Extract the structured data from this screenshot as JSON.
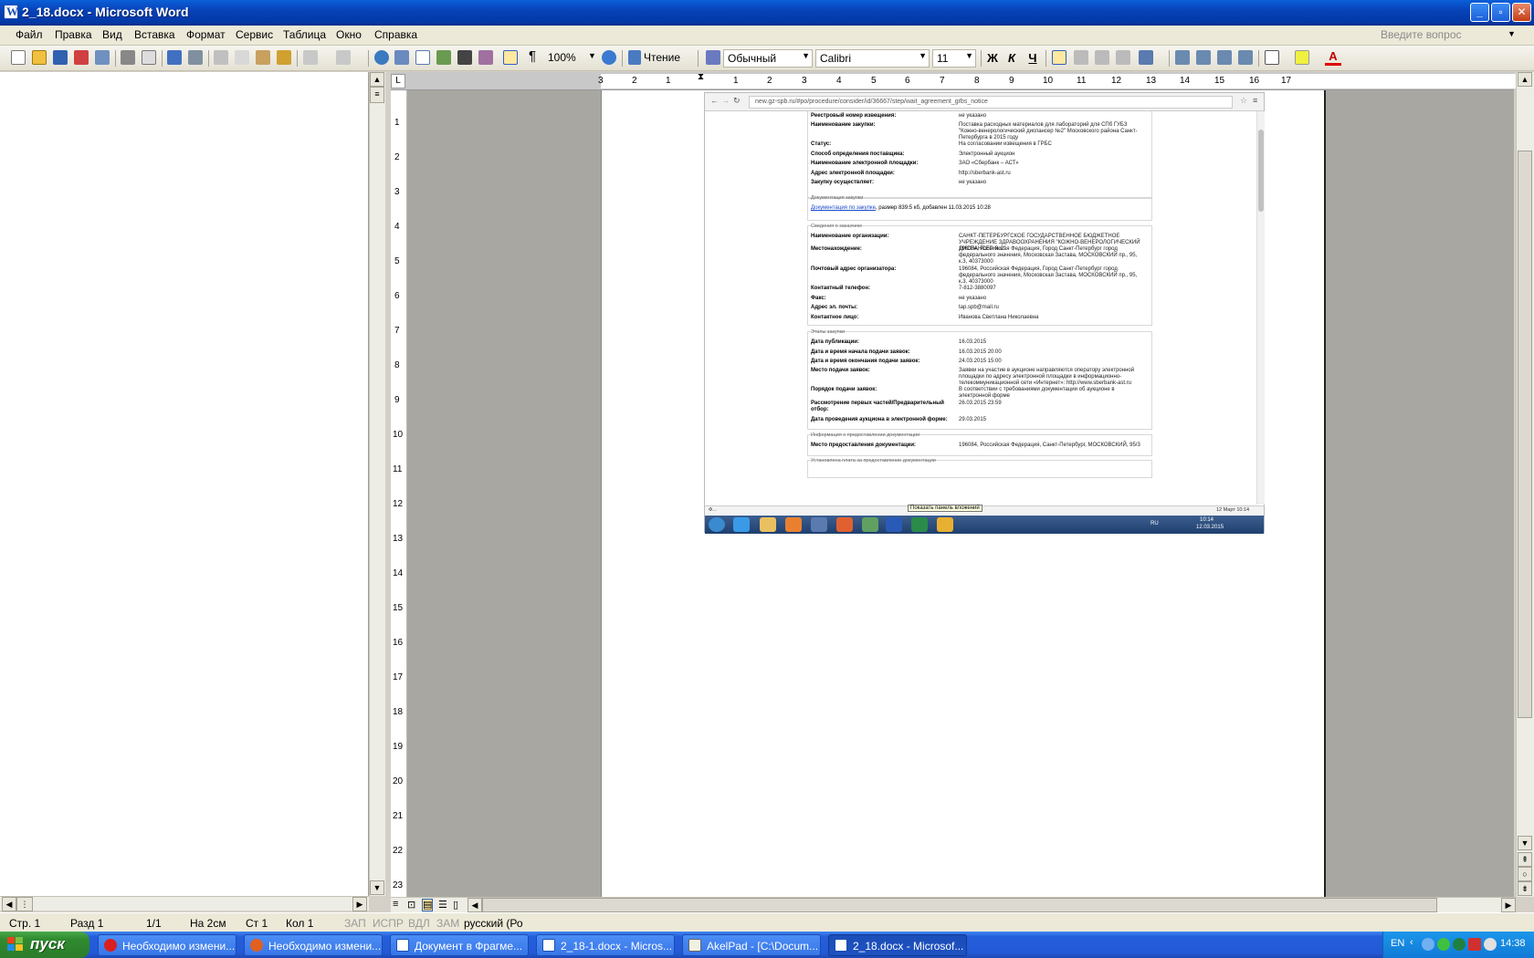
{
  "window": {
    "title": "2_18.docx - Microsoft Word"
  },
  "menu": {
    "items": [
      "Файл",
      "Правка",
      "Вид",
      "Вставка",
      "Формат",
      "Сервис",
      "Таблица",
      "Окно",
      "Справка"
    ],
    "ask_placeholder": "Введите вопрос"
  },
  "toolbar": {
    "zoom": "100%",
    "reading_label": "Чтение",
    "style": "Обычный",
    "font": "Calibri",
    "font_size": "11",
    "bold": "Ж",
    "italic": "К",
    "underline": "Ч",
    "font_color_letter": "A",
    "pilcrow": "¶"
  },
  "ruler": {
    "h_ticks": [
      "3",
      "2",
      "1",
      "1",
      "2",
      "3",
      "4",
      "5",
      "6",
      "7",
      "8",
      "9",
      "10",
      "11",
      "12",
      "13",
      "14",
      "15",
      "16",
      "17"
    ],
    "v_ticks": [
      "1",
      "2",
      "3",
      "4",
      "5",
      "6",
      "7",
      "8",
      "9",
      "10",
      "11",
      "12",
      "13",
      "14",
      "15",
      "16",
      "17",
      "18",
      "19",
      "20",
      "21",
      "22",
      "23"
    ]
  },
  "embedded": {
    "url": "new.gz-spb.ru/#po/procedure/consider/id/36667/step/wait_agreement_grbs_notice",
    "rows_a": [
      {
        "k": "Реестровый номер извещения:",
        "v": "не указано"
      },
      {
        "k": "Наименование закупки:",
        "v": "Поставка расходных материалов для лабораторий для СПб ГУБЗ \"Кожно-венерологический диспансер №2\" Московского района Санкт-Петербурга в 2015 году"
      },
      {
        "k": "Статус:",
        "v": "На согласовании извещения в ГРБС"
      },
      {
        "k": "Способ определения поставщика:",
        "v": "Электронный аукцион"
      },
      {
        "k": "Наименование электронной площадки:",
        "v": "ЗАО «Сбербанк – АСТ»"
      },
      {
        "k": "Адрес электронной площадки:",
        "v": "http://sberbank-ast.ru"
      },
      {
        "k": "Закупку осуществляет:",
        "v": "не указано"
      }
    ],
    "sec_docs": "Документация закупки",
    "doc_link": "Документация по закупке",
    "doc_info": ", размер 839.5 кб, добавлен 11.03.2015 10:28",
    "sec_customer": "Сведения о заказчике",
    "rows_b": [
      {
        "k": "Наименование организации:",
        "v": "САНКТ-ПЕТЕРБУРГСКОЕ ГОСУДАРСТВЕННОЕ БЮДЖЕТНОЕ УЧРЕЖДЕНИЕ ЗДРАВООХРАНЕНИЯ \"КОЖНО-ВЕНЕРОЛОГИЧЕСКИЙ ДИСПАНСЕР №2\""
      },
      {
        "k": "Местонахождение:",
        "v": "196084, Российская Федерация, Город Санкт-Петербург город федерального значения, Московская Застава, МОСКОВСКИЙ пр., 95, к.3, 40373000"
      },
      {
        "k": "Почтовый адрес организатора:",
        "v": "196084, Российская Федерация, Город Санкт-Петербург город федерального значения, Московская Застава, МОСКОВСКИЙ пр., 95, к.3, 40373000"
      },
      {
        "k": "Контактный телефон:",
        "v": "7-812-3880097"
      },
      {
        "k": "Факс:",
        "v": "не указано"
      },
      {
        "k": "Адрес эл. почты:",
        "v": "tap.spb@mail.ru"
      },
      {
        "k": "Контактное лицо:",
        "v": "Иванова Светлана Николаевна"
      }
    ],
    "sec_stages": "Этапы закупки",
    "rows_c": [
      {
        "k": "Дата публикации:",
        "v": "16.03.2015"
      },
      {
        "k": "Дата и время начала подачи заявок:",
        "v": "16.03.2015 20:00"
      },
      {
        "k": "Дата и время окончания подачи заявок:",
        "v": "24.03.2015 15:00"
      },
      {
        "k": "Место подачи заявок:",
        "v": "Заявки на участие в аукционе направляются оператору электронной площадки по адресу электронной площадки в информационно-телекоммуникационной сети «Интернет»: http://www.sberbank-ast.ru"
      },
      {
        "k": "Порядок подачи заявок:",
        "v": "В соответствии с требованиями документации об аукционе в электронной форме"
      },
      {
        "k": "Рассмотрение первых частей/Предварительный отбор:",
        "v": "26.03.2015 23:59"
      },
      {
        "k": "Дата проведения аукциона в электронной форме:",
        "v": "29.03.2015"
      }
    ],
    "sec_docinfo": "Информация о предоставлении документации",
    "rows_d": [
      {
        "k": "Место предоставления документации:",
        "v": "196084, Российская Федерация, Санкт-Петербург, МОСКОВСКИЙ, 95/3"
      }
    ],
    "sec_fee": "Установлена плата за предоставление документации",
    "status_left": "Ф...",
    "status_right": "12 Март 10:14",
    "tooltip": "Показать панель вложений",
    "tray_lang": "RU",
    "tray_time": "10:14",
    "tray_date": "12.03.2015"
  },
  "statusbar": {
    "page": "Стр. 1",
    "section": "Разд 1",
    "pages": "1/1",
    "at": "На 2см",
    "line": "Ст 1",
    "col": "Кол 1",
    "rec": "ЗАП",
    "trk": "ИСПР",
    "ext": "ВДЛ",
    "ovr": "ЗАМ",
    "lang": "русский (Ро"
  },
  "taskbar": {
    "start": "пуск",
    "tasks": [
      "Необходимо измени...",
      "Необходимо измени...",
      "Документ в Фрагме...",
      "2_18-1.docx - Micros...",
      "AkelPad - [C:\\Docum...",
      "2_18.docx - Microsof..."
    ],
    "lang": "EN",
    "time": "14:38"
  },
  "colors": {
    "title_bar": "#0842b8",
    "taskbar": "#245edb",
    "start": "#2f8a2f",
    "doc_background": "#a8a7a1"
  }
}
